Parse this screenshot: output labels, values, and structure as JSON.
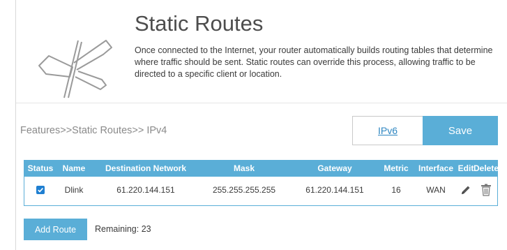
{
  "header": {
    "title": "Static Routes",
    "description": "Once connected to the Internet, your router automatically builds routing tables that determine where traffic should be sent. Static routes can override this process, allowing traffic to be directed to a specific client or location.",
    "icon": "signpost-icon"
  },
  "breadcrumb": "Features>>Static Routes>> IPv4",
  "tabs": {
    "ipv6_label": "IPv6",
    "save_label": "Save"
  },
  "table": {
    "columns": [
      "Status",
      "Name",
      "Destination Network",
      "Mask",
      "Gateway",
      "Metric",
      "Interface",
      "Edit",
      "Delete"
    ],
    "rows": [
      {
        "status_checked": true,
        "name": "Dlink",
        "destination": "61.220.144.151",
        "mask": "255.255.255.255",
        "gateway": "61.220.144.151",
        "metric": "16",
        "interface": "WAN",
        "edit_icon": "pencil-icon",
        "delete_icon": "trash-icon"
      }
    ]
  },
  "footer": {
    "add_label": "Add Route",
    "remaining": "Remaining: 23"
  },
  "colors": {
    "accent": "#5aaed7",
    "checkbox": "#1f7fd1",
    "link": "#2e86c1"
  }
}
